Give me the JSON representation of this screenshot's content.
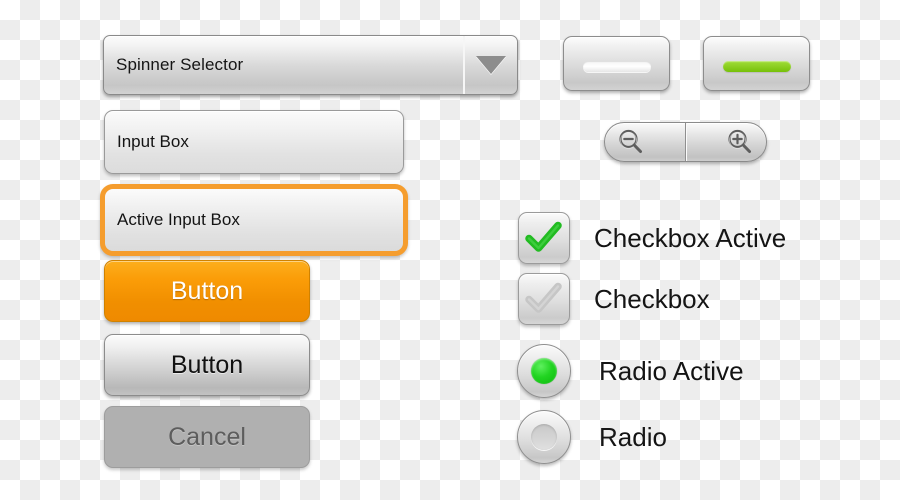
{
  "spinner": {
    "label": "Spinner Selector",
    "arrow_icon": "chevron-down-icon"
  },
  "inputs": {
    "default": {
      "value": "Input Box"
    },
    "active": {
      "value": "Active Input Box",
      "focus_color": "#f59d2e"
    }
  },
  "buttons": {
    "primary": {
      "label": "Button",
      "color": "#f79000"
    },
    "default": {
      "label": "Button"
    },
    "cancel": {
      "label": "Cancel"
    }
  },
  "bar_buttons": {
    "off": {
      "state": "off",
      "bar_color": "#ffffff"
    },
    "on": {
      "state": "on",
      "bar_color": "#8ed024"
    }
  },
  "zoom_control": {
    "zoom_out_icon": "magnifier-minus-icon",
    "zoom_in_icon": "magnifier-plus-icon"
  },
  "checkboxes": [
    {
      "label": "Checkbox Active",
      "checked": true,
      "check_color": "#22bb22",
      "icon": "check-icon"
    },
    {
      "label": "Checkbox",
      "checked": false,
      "check_color": "#c4c4c4",
      "icon": "check-icon"
    }
  ],
  "radios": [
    {
      "label": "Radio Active",
      "selected": true,
      "dot_color": "#1ace1a"
    },
    {
      "label": "Radio",
      "selected": false,
      "dot_color": "#d2d2d2"
    }
  ]
}
